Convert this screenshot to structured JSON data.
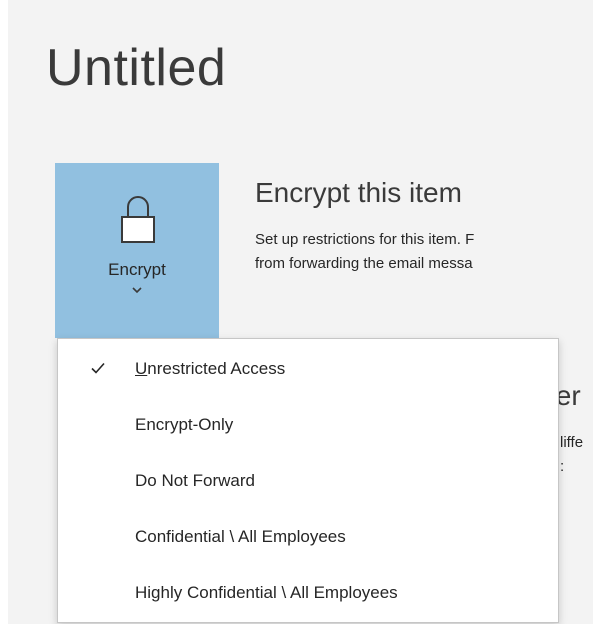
{
  "page": {
    "title": "Untitled"
  },
  "encrypt_button": {
    "label": "Encrypt",
    "icon": "lock-icon",
    "color": "#91c0e0"
  },
  "section": {
    "heading": "Encrypt this item",
    "description_line1": "Set up restrictions for this item. F",
    "description_line2": "from forwarding the email messa"
  },
  "obscured": {
    "heading_fragment": "fer",
    "line1": "liffe",
    "line2": ":"
  },
  "menu": {
    "items": [
      {
        "access_key": "U",
        "rest": "nrestricted Access",
        "checked": true
      },
      {
        "label": "Encrypt-Only"
      },
      {
        "label": "Do Not Forward"
      },
      {
        "label": "Confidential \\ All Employees"
      },
      {
        "label": "Highly Confidential \\ All Employees"
      }
    ]
  }
}
